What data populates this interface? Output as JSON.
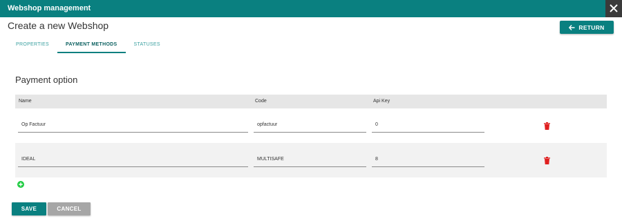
{
  "window": {
    "title": "Webshop management"
  },
  "page": {
    "title": "Create a new Webshop",
    "return_label": "RETURN"
  },
  "tabs": [
    {
      "label": "PROPERTIES",
      "active": false
    },
    {
      "label": "PAYMENT METHODS",
      "active": true
    },
    {
      "label": "STATUSES",
      "active": false
    }
  ],
  "section": {
    "title": "Payment option"
  },
  "table": {
    "columns": [
      "Name",
      "Code",
      "Api Key"
    ],
    "rows": [
      {
        "name": "Op Factuur",
        "code": "opfactuur",
        "api_key": "0"
      },
      {
        "name": "IDEAL",
        "code": "MULTISAFE",
        "api_key": "8"
      }
    ]
  },
  "footer": {
    "save_label": "SAVE",
    "cancel_label": "CANCEL"
  },
  "colors": {
    "accent": "#0a8080",
    "danger": "#e02020",
    "add": "#22cc44"
  },
  "icons": {
    "close": "close-icon",
    "back": "arrow-left-icon",
    "delete": "trash-icon",
    "add": "plus-circle-icon"
  }
}
